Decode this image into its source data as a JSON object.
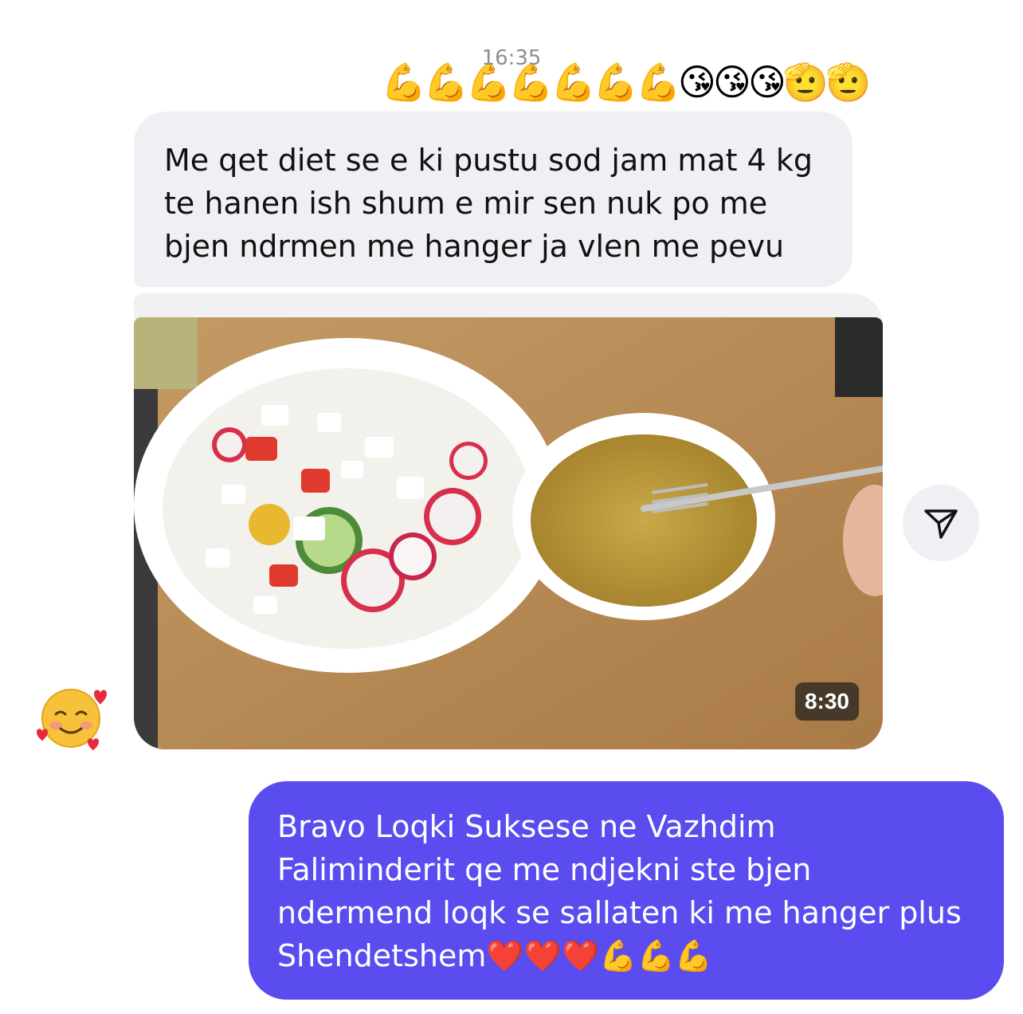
{
  "conversation": {
    "timestamp": "16:35",
    "top_reaction_emojis": "💪💪💪💪💪💪💪😘😘😘🫡🫡",
    "incoming_message": {
      "text": "Me qet diet se e ki pustu sod jam mat 4 kg\nte  hanen  ish shum e mir sen nuk po me\nbjen ndrmen me hanger ja vlen me pevu"
    },
    "shared_video": {
      "duration": "8:30",
      "description_icon": "video-thumbnail"
    },
    "share_button": {
      "icon": "send-icon"
    },
    "reaction_emoji": {
      "icon": "smiling-face-with-hearts-icon"
    },
    "outgoing_message": {
      "text": "Bravo Loqki Suksese ne Vazhdim\nFaliminderit qe me ndjekni ste bjen\nndermend loqk se sallaten ki me hanger plus\nShendetshem❤️❤️❤️💪💪💪"
    }
  },
  "colors": {
    "incoming_bubble": "#efeff4",
    "outgoing_bubble": "#5b4cf0",
    "timestamp": "#8e8e93"
  }
}
